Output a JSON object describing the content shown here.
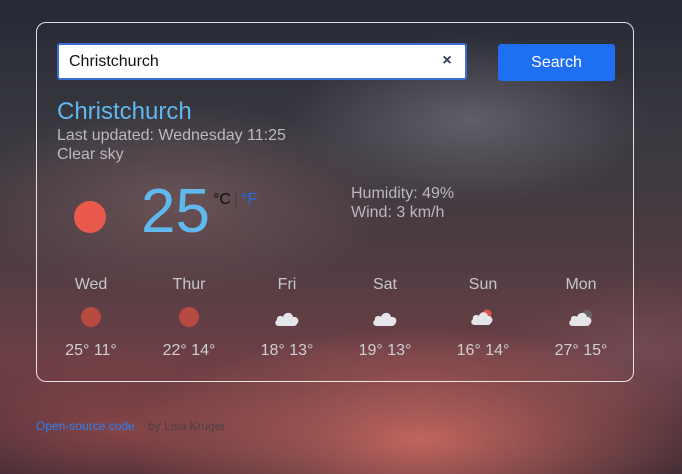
{
  "search": {
    "value": "Christchurch",
    "clear_label": "×",
    "button_label": "Search"
  },
  "current": {
    "city": "Christchurch",
    "last_updated": "Last updated: Wednesday 11:25",
    "description": "Clear sky",
    "icon": "sun-icon",
    "temperature": "25",
    "unit_c": "°C",
    "unit_sep": "|",
    "unit_f": "°F",
    "humidity": "Humidity: 49%",
    "wind": "Wind: 3 km/h"
  },
  "forecast": [
    {
      "day": "Wed",
      "icon": "sun-icon",
      "temps": "25° 11°"
    },
    {
      "day": "Thur",
      "icon": "sun-icon",
      "temps": "22° 14°"
    },
    {
      "day": "Fri",
      "icon": "cloud-icon",
      "temps": "18° 13°"
    },
    {
      "day": "Sat",
      "icon": "cloud-icon",
      "temps": "19° 13°"
    },
    {
      "day": "Sun",
      "icon": "partly-cloudy-icon",
      "temps": "16° 14°"
    },
    {
      "day": "Mon",
      "icon": "partly-cloudy-night-icon",
      "temps": "27° 15°"
    }
  ],
  "footer": {
    "link_label": "Open-source code",
    "credit": "by Lisa Kruger"
  },
  "colors": {
    "accent": "#1f6ff2",
    "city": "#5fb8ee",
    "sun": "#ea5a4c"
  }
}
